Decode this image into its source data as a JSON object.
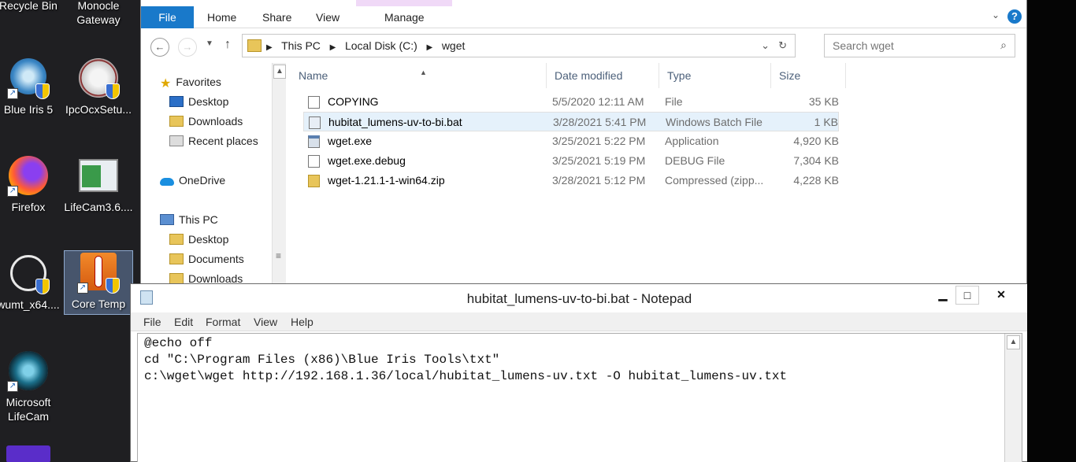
{
  "desktop": {
    "icons": [
      {
        "label": "Recycle Bin",
        "icon": "recycle-bin-icon"
      },
      {
        "label": "Monocle Gateway",
        "icon": "monocle-icon"
      },
      {
        "label": "Blue Iris 5",
        "icon": "blue-iris-icon"
      },
      {
        "label": "IpcOcxSetu...",
        "icon": "ipc-setup-icon"
      },
      {
        "label": "Firefox",
        "icon": "firefox-icon"
      },
      {
        "label": "LifeCam3.6....",
        "icon": "lifecam-installer-icon"
      },
      {
        "label": "wumt_x64....",
        "icon": "wumt-icon"
      },
      {
        "label": "Core Temp",
        "icon": "core-temp-icon"
      },
      {
        "label": "Microsoft LifeCam",
        "icon": "microsoft-lifecam-icon"
      }
    ]
  },
  "explorer": {
    "ribbon": {
      "file": "File",
      "home": "Home",
      "share": "Share",
      "view": "View",
      "manage": "Manage"
    },
    "address": {
      "crumbs": [
        "This PC",
        "Local Disk (C:)",
        "wget"
      ]
    },
    "search": {
      "placeholder": "Search wget"
    },
    "navpane": {
      "favorites": "Favorites",
      "desktop": "Desktop",
      "downloads": "Downloads",
      "recent": "Recent places",
      "onedrive": "OneDrive",
      "thispc": "This PC",
      "pc_desktop": "Desktop",
      "pc_documents": "Documents",
      "pc_downloads": "Downloads"
    },
    "columns": {
      "name": "Name",
      "date": "Date modified",
      "type": "Type",
      "size": "Size"
    },
    "files": [
      {
        "name": "COPYING",
        "date": "5/5/2020 12:11 AM",
        "type": "File",
        "size": "35 KB"
      },
      {
        "name": "hubitat_lumens-uv-to-bi.bat",
        "date": "3/28/2021 5:41 PM",
        "type": "Windows Batch File",
        "size": "1 KB"
      },
      {
        "name": "wget.exe",
        "date": "3/25/2021 5:22 PM",
        "type": "Application",
        "size": "4,920 KB"
      },
      {
        "name": "wget.exe.debug",
        "date": "3/25/2021 5:19 PM",
        "type": "DEBUG File",
        "size": "7,304 KB"
      },
      {
        "name": "wget-1.21.1-1-win64.zip",
        "date": "3/28/2021 5:12 PM",
        "type": "Compressed (zipp...",
        "size": "4,228 KB"
      }
    ]
  },
  "notepad": {
    "title": "hubitat_lumens-uv-to-bi.bat - Notepad",
    "menu": {
      "file": "File",
      "edit": "Edit",
      "format": "Format",
      "view": "View",
      "help": "Help"
    },
    "content": "@echo off\ncd \"C:\\Program Files (x86)\\Blue Iris Tools\\txt\"\nc:\\wget\\wget http://192.168.1.36/local/hubitat_lumens-uv.txt -O hubitat_lumens-uv.txt"
  }
}
